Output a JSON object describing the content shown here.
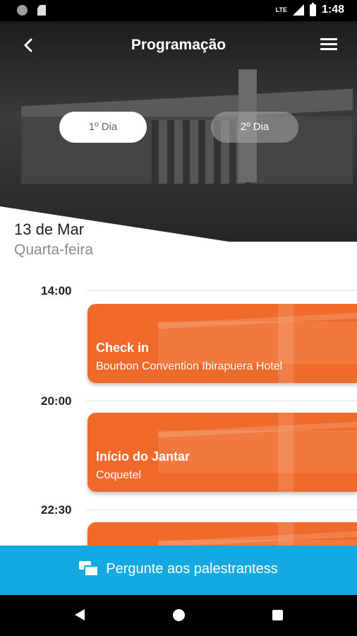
{
  "status_bar": {
    "network": "LTE",
    "time": "1:48"
  },
  "header": {
    "title": "Programação",
    "back_icon": "chevron-left-icon",
    "menu_icon": "hamburger-menu-icon"
  },
  "day_tabs": [
    {
      "label": "1º Dia",
      "selected": true
    },
    {
      "label": "2º Dia",
      "selected": false
    }
  ],
  "date": {
    "day": "13 de Mar",
    "weekday": "Quarta-feira"
  },
  "schedule": [
    {
      "time": "14:00",
      "title": "Check in",
      "subtitle": "Bourbon Convention Ibirapuera Hotel"
    },
    {
      "time": "20:00",
      "title": "Início do Jantar",
      "subtitle": "Coquetel"
    },
    {
      "time": "22:30",
      "title": "",
      "subtitle": ""
    }
  ],
  "ask_button": {
    "label": "Pergunte aos palestrantess",
    "icon": "chat-icon"
  },
  "colors": {
    "accent": "#ef6a2b",
    "action": "#14a9e2"
  }
}
